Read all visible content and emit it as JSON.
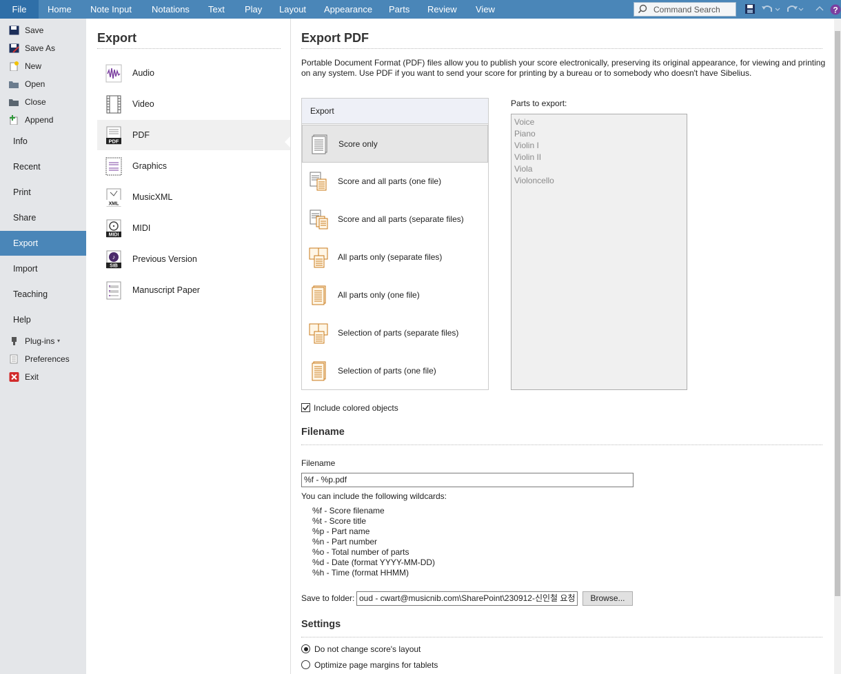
{
  "ribbon": {
    "tabs": [
      "File",
      "Home",
      "Note Input",
      "Notations",
      "Text",
      "Play",
      "Layout",
      "Appearance",
      "Parts",
      "Review",
      "View"
    ],
    "command_search_placeholder": "Command Search"
  },
  "nav": {
    "top_items": [
      {
        "label": "Save",
        "icon": "save-icon"
      },
      {
        "label": "Save As",
        "icon": "save-as-icon"
      },
      {
        "label": "New",
        "icon": "new-icon"
      },
      {
        "label": "Open",
        "icon": "open-folder-icon"
      },
      {
        "label": "Close",
        "icon": "close-folder-icon"
      },
      {
        "label": "Append",
        "icon": "append-icon"
      }
    ],
    "sections": [
      "Info",
      "Recent",
      "Print",
      "Share",
      "Export",
      "Import",
      "Teaching",
      "Help"
    ],
    "active_section": "Export",
    "bottom_items": [
      {
        "label": "Plug-ins",
        "icon": "plugin-icon"
      },
      {
        "label": "Preferences",
        "icon": "preferences-icon"
      },
      {
        "label": "Exit",
        "icon": "exit-icon"
      }
    ]
  },
  "export_categories": {
    "title": "Export",
    "items": [
      {
        "label": "Audio",
        "icon": "audio-waveform-icon"
      },
      {
        "label": "Video",
        "icon": "video-film-icon"
      },
      {
        "label": "PDF",
        "icon": "pdf-icon"
      },
      {
        "label": "Graphics",
        "icon": "graphics-icon"
      },
      {
        "label": "MusicXML",
        "icon": "musicxml-icon"
      },
      {
        "label": "MIDI",
        "icon": "midi-icon"
      },
      {
        "label": "Previous Version",
        "icon": "sib-file-icon"
      },
      {
        "label": "Manuscript Paper",
        "icon": "manuscript-paper-icon"
      }
    ],
    "active": "PDF"
  },
  "main": {
    "title": "Export PDF",
    "description": "Portable Document Format (PDF) files allow you to publish your score electronically, preserving its original appearance, for viewing and printing on any system. Use PDF if you want to send your score for printing by a bureau or to somebody who doesn't have Sibelius.",
    "export_header": "Export",
    "export_options": [
      {
        "label": "Score only",
        "icon": "score-page-icon"
      },
      {
        "label": "Score and all parts (one file)",
        "icon": "score-parts-icon"
      },
      {
        "label": "Score and all parts (separate files)",
        "icon": "score-parts-separate-icon"
      },
      {
        "label": "All parts only (separate files)",
        "icon": "parts-separate-icon"
      },
      {
        "label": "All parts only (one file)",
        "icon": "parts-one-file-icon"
      },
      {
        "label": "Selection of parts (separate files)",
        "icon": "selection-separate-icon"
      },
      {
        "label": "Selection of parts (one file)",
        "icon": "selection-one-file-icon"
      }
    ],
    "selected_option": "Score only",
    "parts_label": "Parts to export:",
    "parts": [
      "Voice",
      "Piano",
      "Violin I",
      "Violin II",
      "Viola",
      "Violoncello"
    ],
    "include_colored_label": "Include colored objects",
    "include_colored_checked": true,
    "filename_section": "Filename",
    "filename_label": "Filename",
    "filename_value": "%f - %p.pdf",
    "wildcards_intro": "You can include the following wildcards:",
    "wildcards": [
      "%f - Score filename",
      "%t - Score title",
      "%p - Part name",
      "%n - Part number",
      "%o - Total number of parts",
      "%d - Date (format YYYY-MM-DD)",
      "%h - Time (format HHMM)"
    ],
    "save_folder_label": "Save to folder:",
    "save_folder_value": "oud - cwart@musicnib.com\\SharePoint\\230912-신인철 요청",
    "browse_label": "Browse...",
    "settings_section": "Settings",
    "settings_options": [
      {
        "label": "Do not change score's layout",
        "selected": true
      },
      {
        "label": "Optimize page margins for tablets",
        "selected": false
      }
    ]
  }
}
